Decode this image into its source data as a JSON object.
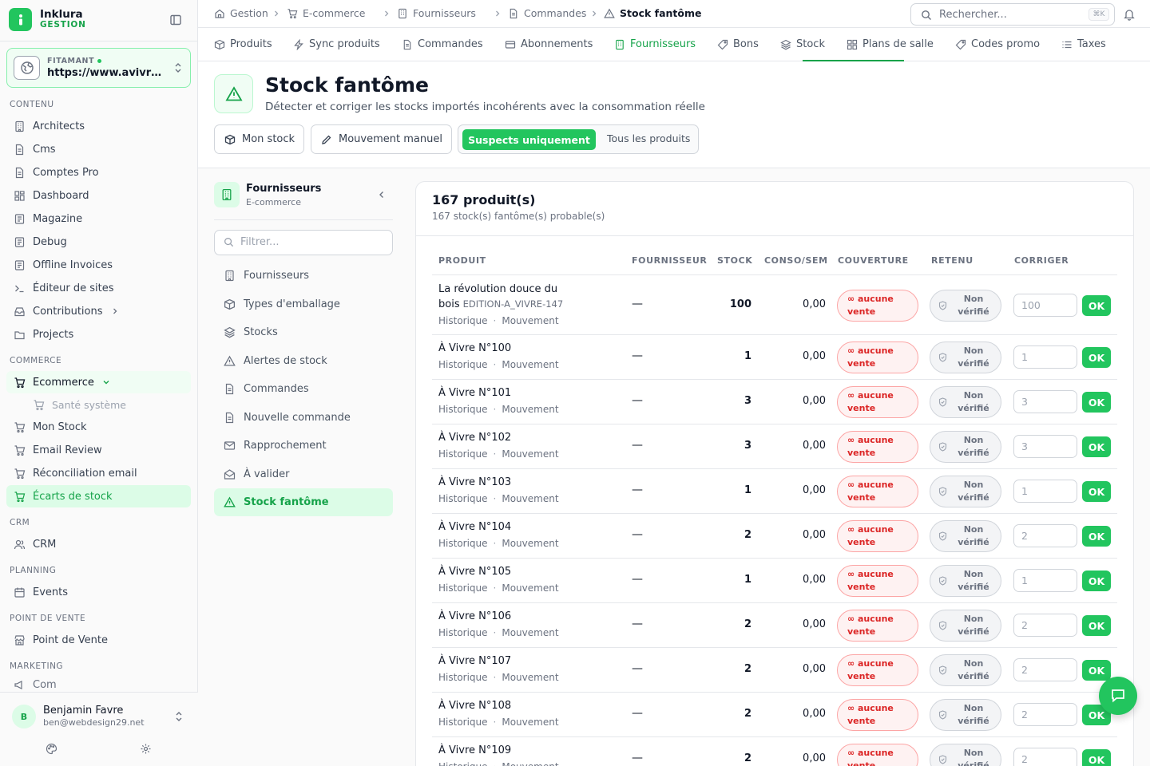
{
  "brand": {
    "name": "Inklura",
    "sub": "GESTION"
  },
  "site": {
    "label": "FITAMANT",
    "url": "https://www.avivre..."
  },
  "sidebar": {
    "sections": [
      {
        "label": "CONTENU"
      },
      {
        "label": "COMMERCE"
      },
      {
        "label": "CRM"
      },
      {
        "label": "PLANNING"
      },
      {
        "label": "POINT DE VENTE"
      },
      {
        "label": "MARKETING"
      }
    ],
    "items": [
      {
        "label": "Architects",
        "icon": "building-icon"
      },
      {
        "label": "Cms",
        "icon": "document-icon"
      },
      {
        "label": "Comptes Pro",
        "icon": "document-icon"
      },
      {
        "label": "Dashboard",
        "icon": "grid-icon"
      },
      {
        "label": "Magazine",
        "icon": "newspaper-icon"
      },
      {
        "label": "Debug",
        "icon": "newspaper-icon"
      },
      {
        "label": "Offline Invoices",
        "icon": "newspaper-icon"
      },
      {
        "label": "Éditeur de sites",
        "icon": "terminal-icon"
      },
      {
        "label": "Contributions",
        "icon": "inbox-icon"
      },
      {
        "label": "Projects",
        "icon": "folder-icon"
      },
      {
        "label": "Ecommerce",
        "icon": "cart-icon"
      },
      {
        "label": "Santé système",
        "icon": "cart-icon"
      },
      {
        "label": "Mon Stock",
        "icon": "cart-icon"
      },
      {
        "label": "Email Review",
        "icon": "cart-icon"
      },
      {
        "label": "Réconciliation email",
        "icon": "cart-icon"
      },
      {
        "label": "Écarts de stock",
        "icon": "cart-icon"
      },
      {
        "label": "CRM",
        "icon": "users-icon"
      },
      {
        "label": "Events",
        "icon": "calendar-icon"
      },
      {
        "label": "Point de Vente",
        "icon": "store-icon"
      },
      {
        "label": "Com",
        "icon": "megaphone-icon"
      }
    ]
  },
  "user": {
    "initial": "B",
    "name": "Benjamin Favre",
    "email": "ben@webdesign29.net"
  },
  "breadcrumb": [
    "Gestion",
    "E-commerce",
    "Fournisseurs",
    "Commandes",
    "Stock fantôme"
  ],
  "search": {
    "placeholder": "Rechercher...",
    "shortcut": "⌘K"
  },
  "tabs": [
    "Produits",
    "Sync produits",
    "Commandes",
    "Abonnements",
    "Fournisseurs",
    "Bons",
    "Stock",
    "Plans de salle",
    "Codes promo",
    "Taxes"
  ],
  "page": {
    "title": "Stock fantôme",
    "subtitle": "Détecter et corriger les stocks importés incohérents avec la consommation réelle",
    "btn_stock": "Mon stock",
    "btn_manual": "Mouvement manuel",
    "seg_on": "Suspects uniquement",
    "seg_off": "Tous les produits"
  },
  "subnav": {
    "title": "Fournisseurs",
    "subtitle": "E-commerce",
    "filter_placeholder": "Filtrer...",
    "items": [
      "Fournisseurs",
      "Types d'emballage",
      "Stocks",
      "Alertes de stock",
      "Commandes",
      "Nouvelle commande",
      "Rapprochement",
      "À valider",
      "Stock fantôme"
    ]
  },
  "table": {
    "title": "167 produit(s)",
    "subtitle": "167 stock(s) fantôme(s) probable(s)",
    "headers": [
      "PRODUIT",
      "FOURNISSEUR",
      "STOCK",
      "CONSO/SEM",
      "COUVERTURE",
      "RETENU",
      "CORRIGER"
    ],
    "link_history": "Historique",
    "link_movement": "Mouvement",
    "dash": "—",
    "badge_red_1": "∞ aucune",
    "badge_red_2": "vente",
    "badge_grey_1": "Non",
    "badge_grey_2": "vérifié",
    "ok": "OK",
    "rows": [
      {
        "name1": "La révolution douce du",
        "name2": "bois",
        "code": "EDITION-A_VIVRE-147",
        "stock": "100",
        "conso": "0,00",
        "fix": "100"
      },
      {
        "name1": "À Vivre N°100",
        "stock": "1",
        "conso": "0,00",
        "fix": "1"
      },
      {
        "name1": "À Vivre N°101",
        "stock": "3",
        "conso": "0,00",
        "fix": "3"
      },
      {
        "name1": "À Vivre N°102",
        "stock": "3",
        "conso": "0,00",
        "fix": "3"
      },
      {
        "name1": "À Vivre N°103",
        "stock": "1",
        "conso": "0,00",
        "fix": "1"
      },
      {
        "name1": "À Vivre N°104",
        "stock": "2",
        "conso": "0,00",
        "fix": "2"
      },
      {
        "name1": "À Vivre N°105",
        "stock": "1",
        "conso": "0,00",
        "fix": "1"
      },
      {
        "name1": "À Vivre N°106",
        "stock": "2",
        "conso": "0,00",
        "fix": "2"
      },
      {
        "name1": "À Vivre N°107",
        "stock": "2",
        "conso": "0,00",
        "fix": "2"
      },
      {
        "name1": "À Vivre N°108",
        "stock": "2",
        "conso": "0,00",
        "fix": "2"
      },
      {
        "name1": "À Vivre N°109",
        "stock": "2",
        "conso": "0,00",
        "fix": "2"
      }
    ]
  },
  "colors": {
    "accent": "#22c55e",
    "accent_dark": "#16a34a",
    "danger": "#dc2626"
  }
}
